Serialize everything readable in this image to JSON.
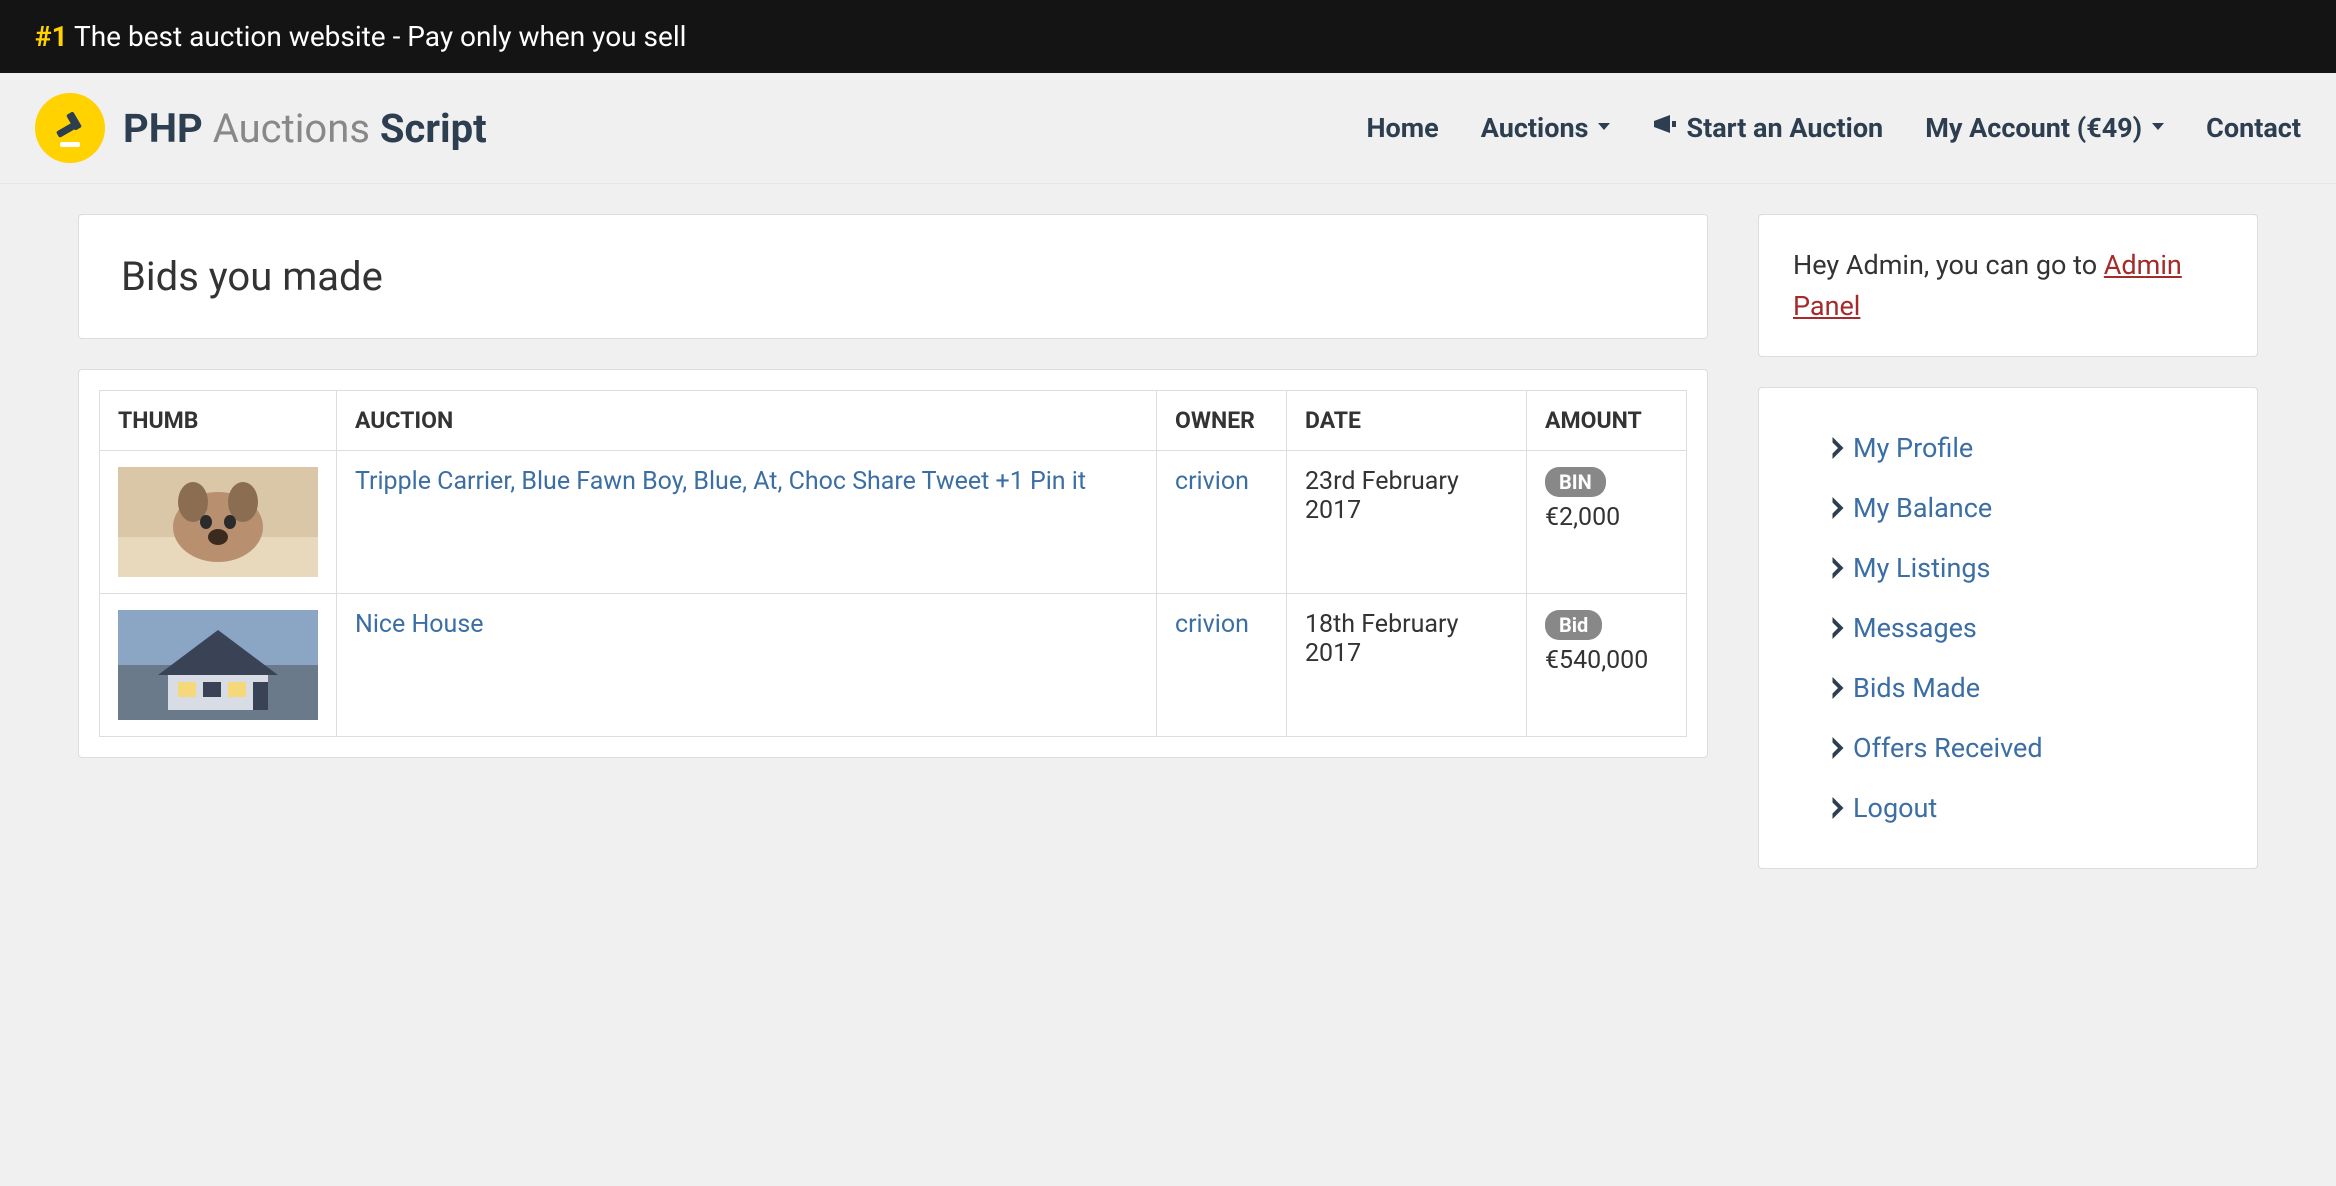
{
  "banner": {
    "hash": "#1",
    "text": " The best auction website - Pay only when you sell"
  },
  "brand": {
    "php": "PHP",
    "auctions": "Auctions",
    "script": "Script"
  },
  "nav": {
    "home": "Home",
    "auctions": "Auctions",
    "start": "Start an Auction",
    "account": "My Account (€49)",
    "contact": "Contact"
  },
  "page_title": "Bids you made",
  "table": {
    "headers": {
      "thumb": "Thumb",
      "auction": "Auction",
      "owner": "Owner",
      "date": "Date",
      "amount": "Amount"
    },
    "rows": [
      {
        "auction": "Tripple Carrier, Blue Fawn Boy, Blue, At, Choc Share Tweet +1 Pin it",
        "owner": "crivion",
        "date": "23rd February 2017",
        "badge": "BIN",
        "amount": "€2,000"
      },
      {
        "auction": "Nice House",
        "owner": "crivion",
        "date": "18th February 2017",
        "badge": "Bid",
        "amount": "€540,000"
      }
    ]
  },
  "admin_notice": {
    "greeting": "Hey Admin, you can go to ",
    "link": "Admin Panel"
  },
  "side_menu": [
    "My Profile",
    "My Balance",
    "My Listings",
    "Messages",
    "Bids Made",
    "Offers Received",
    "Logout"
  ]
}
